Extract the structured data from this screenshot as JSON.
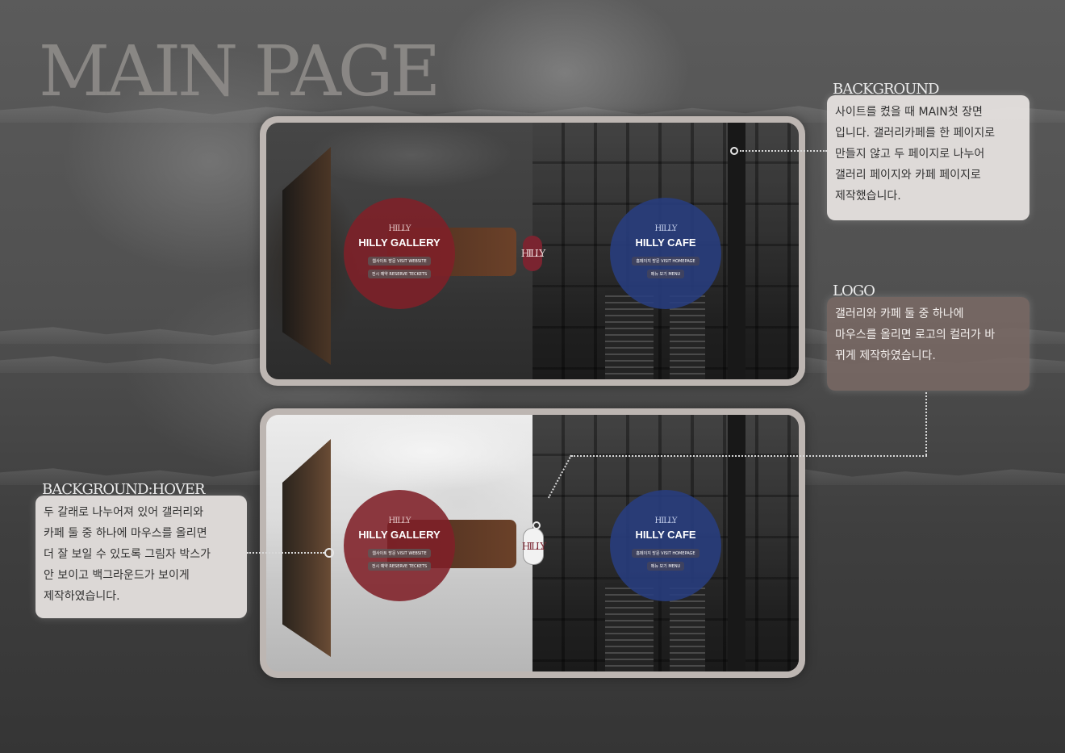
{
  "page_title": "MAIN PAGE",
  "panels": [
    {
      "state": "default",
      "gallery": {
        "name": "HILLY GALLERY",
        "logo": "HILLY",
        "buttons": [
          "웹사이트 방문 VISIT WEBSITE",
          "전시 예약 RESERVE TECKETS"
        ]
      },
      "center_logo": "HILLY",
      "cafe": {
        "name": "HILLY CAFE",
        "logo": "HILLY",
        "buttons": [
          "홈페이지 방문 VISIT HOMEPAGE",
          "메뉴 보기 MENU"
        ]
      }
    },
    {
      "state": "hover",
      "gallery": {
        "name": "HILLY GALLERY",
        "logo": "HILLY",
        "buttons": [
          "웹사이트 방문 VISIT WEBSITE",
          "전시 예약 RESERVE TECKETS"
        ]
      },
      "center_logo": "HILLY",
      "cafe": {
        "name": "HILLY CAFE",
        "logo": "HILLY",
        "buttons": [
          "홈페이지 방문 VISIT HOMEPAGE",
          "메뉴 보기 MENU"
        ]
      }
    }
  ],
  "annotations": {
    "background": {
      "title": "BACKGROUND",
      "lines": [
        "사이트를 켰을 때 MAIN첫 장면",
        "입니다. 갤러리카페를 한 페이지로",
        "만들지 않고 두 페이지로 나누어",
        "갤러리 페이지와 카페 페이지로",
        "제작했습니다."
      ]
    },
    "logo": {
      "title": "LOGO",
      "lines": [
        "갤러리와 카페 둘 중 하나에",
        "마우스를 올리면 로고의 컬러가 바",
        "뀌게 제작하였습니다."
      ]
    },
    "background_hover": {
      "title": "BACKGROUND:HOVER",
      "lines": [
        "두 갈래로 나누어져 있어 갤러리와",
        "카페 둘 중 하나에 마우스를 올리면",
        "더 잘 보일 수 있도록 그림자 박스가",
        "안 보이고 백그라운드가 보이게",
        "제작하였습니다."
      ]
    }
  },
  "colors": {
    "gallery_accent": "#802028",
    "cafe_accent": "#283e80",
    "frame": "#bdb6b2"
  }
}
